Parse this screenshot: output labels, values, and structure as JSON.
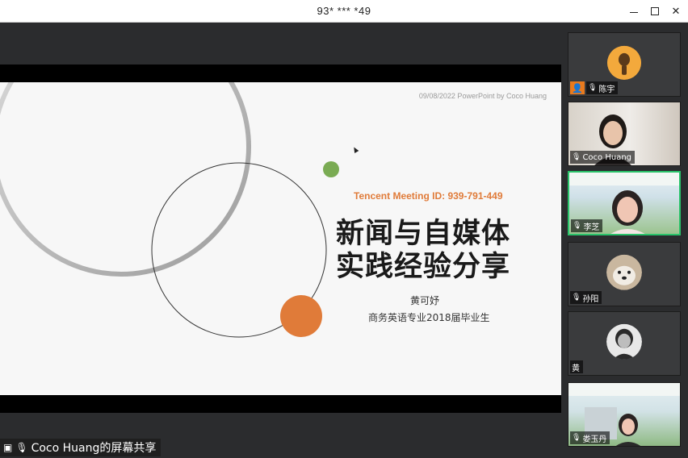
{
  "window": {
    "title": "93* *** *49"
  },
  "slide": {
    "date_line": "09/08/2022 PowerPoint by Coco Huang",
    "meeting_id": "Tencent Meeting ID: 939-791-449",
    "title_line1": "新闻与自媒体",
    "title_line2": "实践经验分享",
    "presenter": "黄可妤",
    "subtitle": "商务英语专业2018届毕业生",
    "accent_orange": "#e07b39",
    "accent_green": "#7aab53"
  },
  "share": {
    "label": "Coco Huang的屏幕共享"
  },
  "participants": [
    {
      "name": "陈宇",
      "type": "avatar",
      "color": "#f3a93c"
    },
    {
      "name": "Coco Huang",
      "type": "video"
    },
    {
      "name": "李芝",
      "type": "video",
      "active": true
    },
    {
      "name": "孙阳",
      "type": "avatar"
    },
    {
      "name": "黄",
      "type": "avatar"
    },
    {
      "name": "娄玉丹",
      "type": "video"
    }
  ]
}
